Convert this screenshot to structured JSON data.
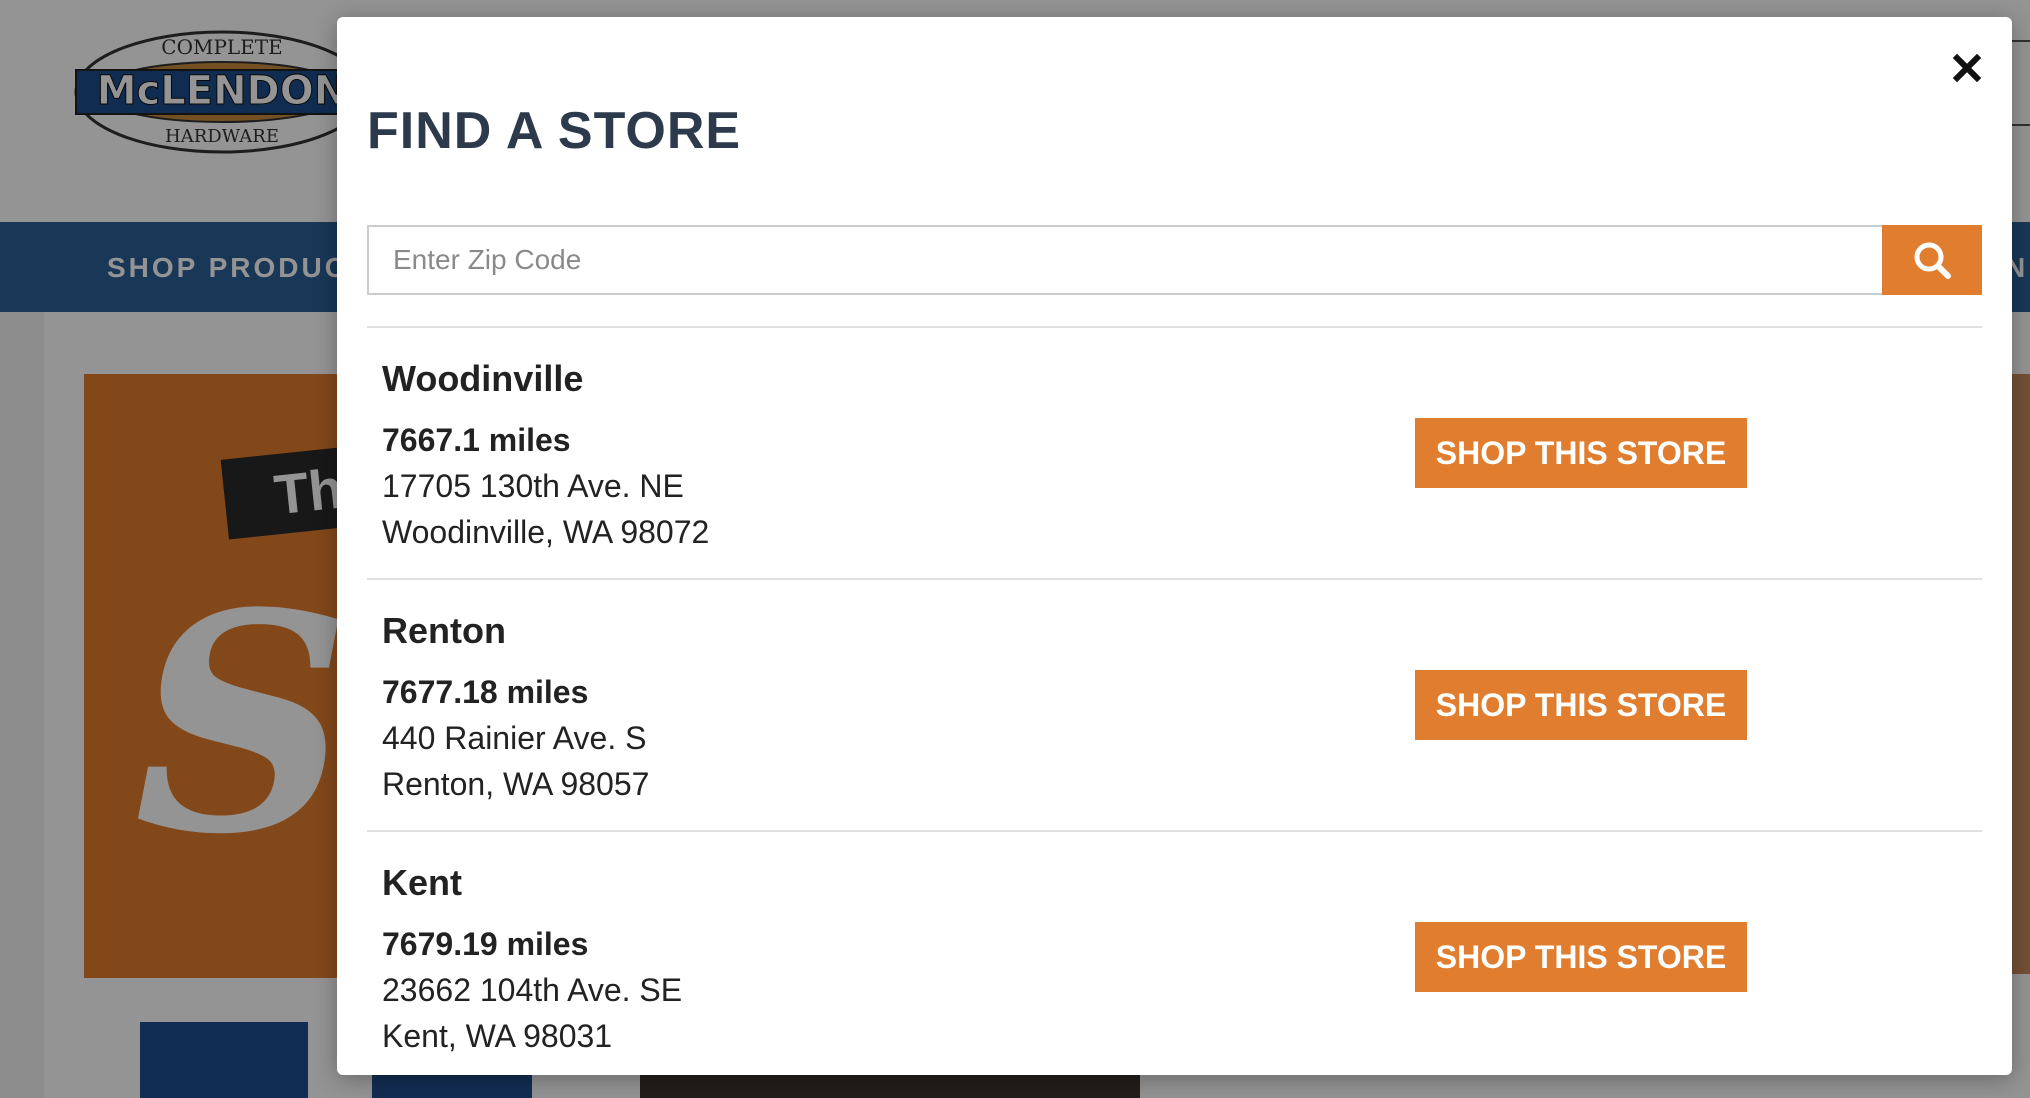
{
  "background": {
    "nav": {
      "shop_products_label": "SHOP PRODUC",
      "right_fragment": "N"
    },
    "hero": {
      "tag_text": "Thr",
      "script_text": "Sp"
    }
  },
  "modal": {
    "title": "FIND A STORE",
    "search": {
      "placeholder": "Enter Zip Code",
      "value": ""
    },
    "stores": [
      {
        "name": "Woodinville",
        "distance": "7667.1 miles",
        "street": "17705 130th Ave. NE",
        "city_state_zip": "Woodinville, WA 98072",
        "button_label": "SHOP THIS STORE"
      },
      {
        "name": "Renton",
        "distance": "7677.18 miles",
        "street": "440 Rainier Ave. S",
        "city_state_zip": "Renton, WA 98057",
        "button_label": "SHOP THIS STORE"
      },
      {
        "name": "Kent",
        "distance": "7679.19 miles",
        "street": "23662 104th Ave. SE",
        "city_state_zip": "Kent, WA 98031",
        "button_label": "SHOP THIS STORE"
      }
    ]
  },
  "icons": {
    "close": "close-icon",
    "search": "search-icon",
    "logo": "mclendon-logo"
  },
  "colors": {
    "accent": "#e07d2e",
    "nav": "#2c5f96",
    "title": "#2d3a4b",
    "text": "#222222"
  }
}
